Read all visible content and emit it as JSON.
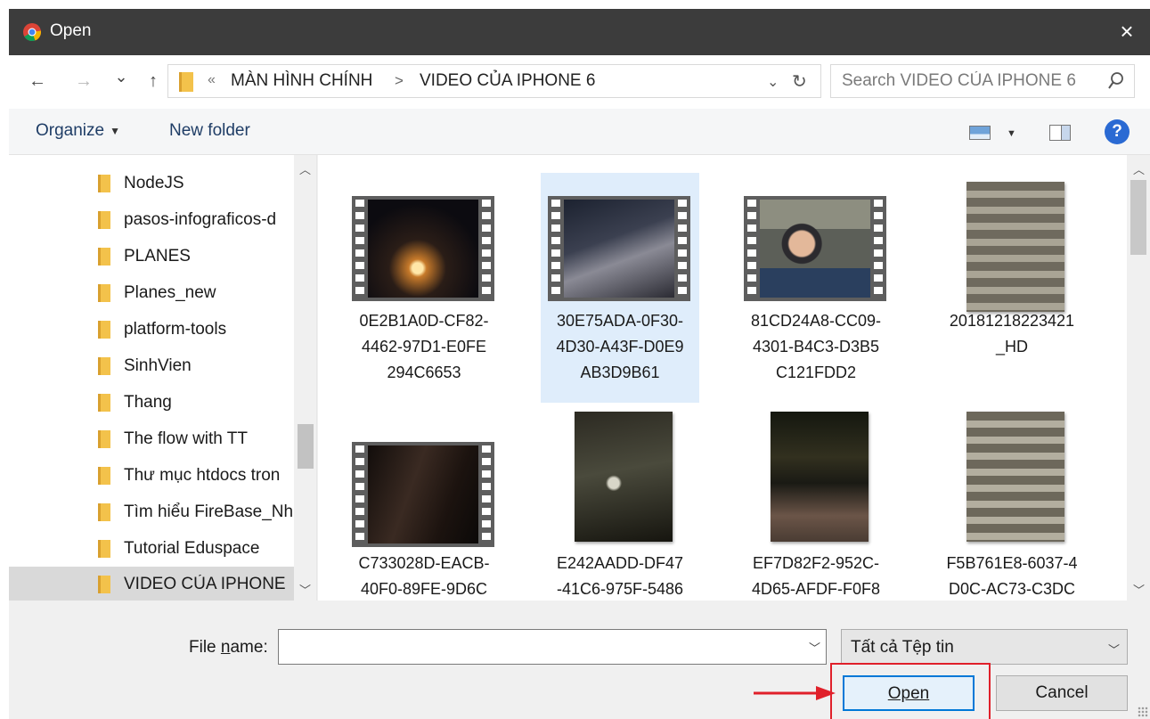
{
  "window": {
    "title": "Open",
    "close_label": "×"
  },
  "toolbar": {
    "back": "←",
    "forward": "→",
    "recent": "⌄",
    "up": "↑"
  },
  "address": {
    "overflow": "«",
    "crumbs": [
      "MÀN HÌNH CHÍNH",
      "VIDEO CỦA IPHONE 6"
    ],
    "separator": ">",
    "dropdown": "⌄",
    "refresh": "↻"
  },
  "search": {
    "placeholder": "Search VIDEO CỦA IPHONE 6"
  },
  "commands": {
    "organize": "Organize",
    "new_folder": "New folder",
    "help": "?"
  },
  "nav": {
    "items": [
      {
        "label": "NodeJS"
      },
      {
        "label": "pasos-infograficos-d"
      },
      {
        "label": "PLANES"
      },
      {
        "label": "Planes_new"
      },
      {
        "label": "platform-tools"
      },
      {
        "label": "SinhVien"
      },
      {
        "label": "Thang"
      },
      {
        "label": "The flow with TT"
      },
      {
        "label": "Thư mục htdocs tron"
      },
      {
        "label": "Tìm hiểu FireBase_Nh"
      },
      {
        "label": "Tutorial Eduspace"
      },
      {
        "label": "VIDEO CỦA IPHONE"
      }
    ],
    "selected_index": 11
  },
  "files": [
    {
      "name": "0E2B1A0D-CF82-\n4462-97D1-E0FE\n294C6653",
      "kind": "video"
    },
    {
      "name": "30E75ADA-0F30-\n4D30-A43F-D0E9\nAB3D9B61",
      "kind": "video",
      "selected": true
    },
    {
      "name": "81CD24A8-CC09-\n4301-B4C3-D3B5\nC121FDD2",
      "kind": "video"
    },
    {
      "name": "20181218223421\n_HD",
      "kind": "photo"
    },
    {
      "name": "C733028D-EACB-\n40F0-89FE-9D6C",
      "kind": "video"
    },
    {
      "name": "E242AADD-DF47\n-41C6-975F-5486",
      "kind": "photo"
    },
    {
      "name": "EF7D82F2-952C-\n4D65-AFDF-F0F8",
      "kind": "photo"
    },
    {
      "name": "F5B761E8-6037-4\nD0C-AC73-C3DC",
      "kind": "photo"
    }
  ],
  "bottom": {
    "file_name_label_pre": "File ",
    "file_name_label_underlined": "n",
    "file_name_label_post": "ame:",
    "file_name_value": "",
    "file_type": "Tất cả Tệp tin",
    "open_label": "Open",
    "cancel_label": "Cancel"
  },
  "colors": {
    "accent": "#0078d7",
    "annotation": "#e0202a",
    "titlebar": "#3c3c3c"
  }
}
